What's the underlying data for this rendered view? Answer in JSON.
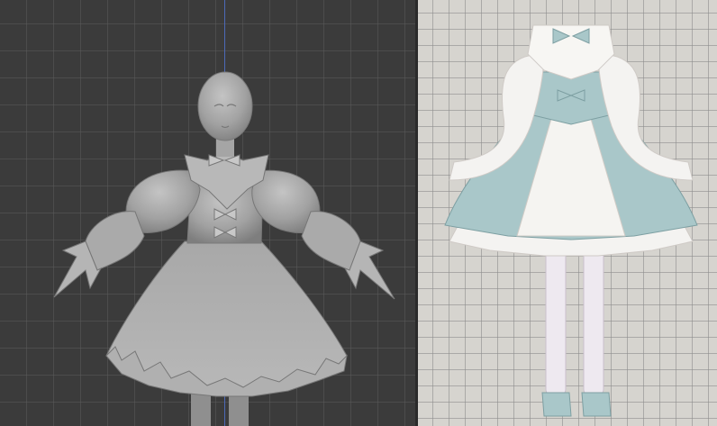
{
  "viewport": {
    "name": "3d-sculpt-viewport"
  },
  "reference": {
    "name": "costume-reference-sheet"
  },
  "colors": {
    "viewport_bg": "#3b3b3b",
    "viewport_grid": "#5a5a5a",
    "axis": "#4d6ab8",
    "clay": "#9c9c9c",
    "reference_bg": "#d6d4cf",
    "dress_blue": "#a9c7c9",
    "dress_white": "#f2f1ee"
  }
}
